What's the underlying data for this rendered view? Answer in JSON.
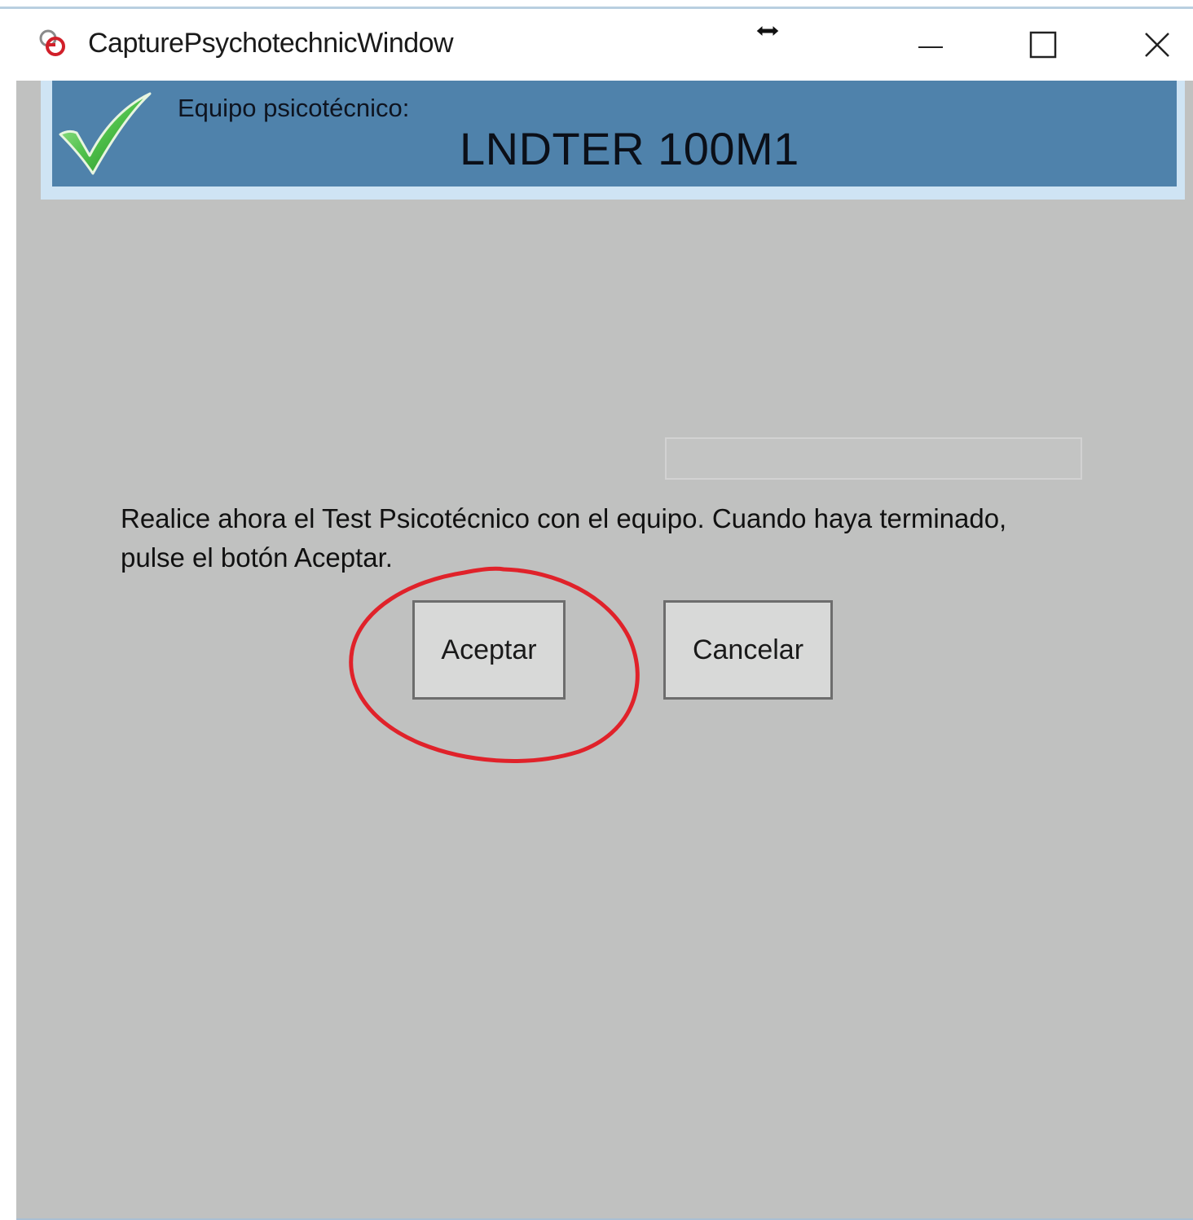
{
  "window": {
    "title": "CapturePsychotechnicWindow",
    "icon": "app-logo-icon",
    "controls": {
      "minimize": "minimize-icon",
      "maximize": "maximize-icon",
      "close": "close-icon"
    },
    "cursor_icon": "horizontal-resize-cursor-icon"
  },
  "header": {
    "status_icon": "green-check-icon",
    "label": "Equipo psicotécnico:",
    "device_name": "LNDTER 100M1"
  },
  "main": {
    "field_value": "",
    "instruction_line1": "Realice ahora el Test Psicotécnico con el equipo. Cuando haya terminado,",
    "instruction_line2": "pulse el botón Aceptar.",
    "accept_label": "Aceptar",
    "cancel_label": "Cancelar"
  },
  "colors": {
    "client_background": "#c0c1c0",
    "header_background": "#4f82ab",
    "annotation_circle": "#e0222a"
  }
}
